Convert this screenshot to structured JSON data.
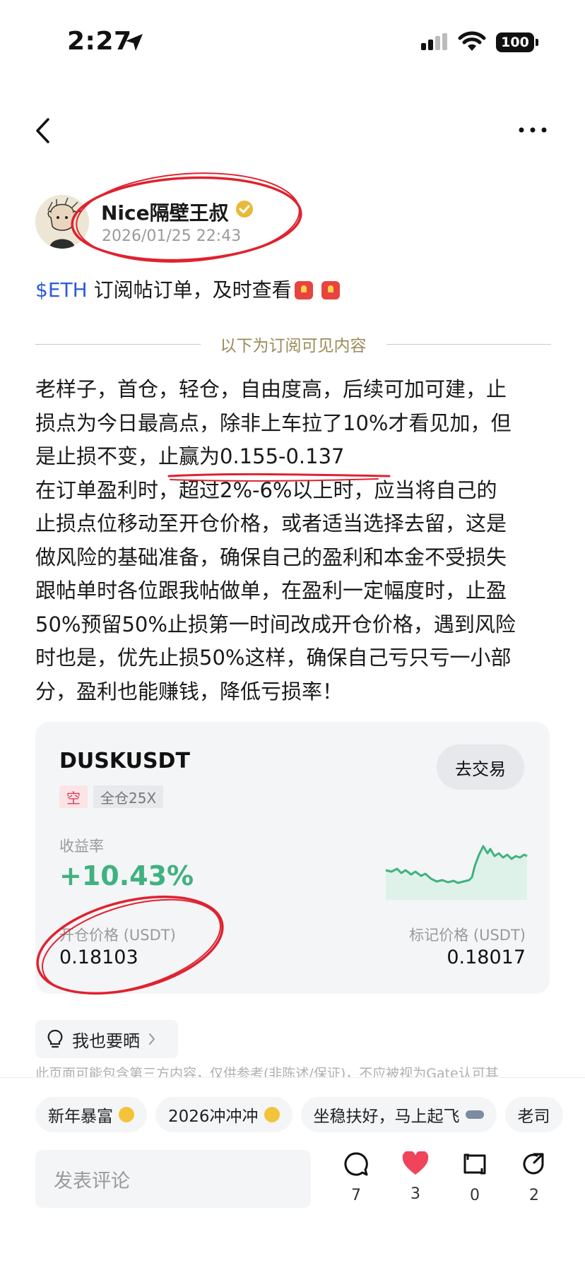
{
  "status": {
    "time": "2:27",
    "battery": "100"
  },
  "author": {
    "name": "Nice隔壁王叔",
    "time": "2026/01/25 22:43"
  },
  "post": {
    "ticker": "$ETH",
    "title_text": " 订阅帖订单，及时查看",
    "divider": "以下为订阅可见内容",
    "lines": [
      "老样子，首仓，轻仓，自由度高，后续可加可建，止",
      "损点为今日最高点，除非上车拉了10%才看见加，但",
      "是止损不变，止赢为0.155-0.137",
      "在订单盈利时，超过2%-6%以上时，应当将自己的",
      "止损点位移动至开仓价格，或者适当选择去留，这是",
      "做风险的基础准备，确保自己的盈利和本金不受损失",
      "跟帖单时各位跟我帖做单，在盈利一定幅度时，止盈",
      "50%预留50%止损第一时间改成开仓价格，遇到风险",
      "时也是，优先止损50%这样，确保自己亏只亏一小部",
      "分，盈利也能赚钱，降低亏损率！"
    ]
  },
  "card": {
    "symbol": "DUSKUSDT",
    "trade_button": "去交易",
    "side": "空",
    "margin": "全仓25X",
    "yield_label": "收益率",
    "yield_value": "+10.43%",
    "open_label": "开仓价格 (USDT)",
    "open_value": "0.18103",
    "mark_label": "标记价格 (USDT)",
    "mark_value": "0.18017",
    "accent": "#3fb27f"
  },
  "share_chip": "我也要晒",
  "disclaimer": "此页面可能包含第三方内容，仅供参考(非陈述/保证)，不应被视为Gate认可其",
  "topics": [
    "新年暴富",
    "2026冲冲冲",
    "坐稳扶好，马上起飞",
    "老司"
  ],
  "comment_placeholder": "发表评论",
  "actions": {
    "comments": "7",
    "likes": "3",
    "reposts": "0",
    "shares": "2"
  }
}
